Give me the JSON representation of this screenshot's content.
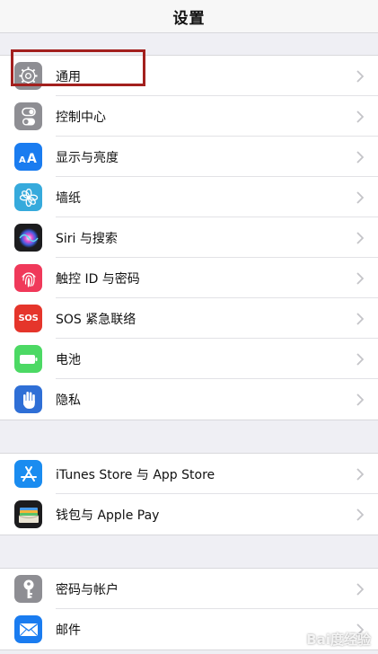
{
  "nav": {
    "title": "设置"
  },
  "groups": [
    {
      "items": [
        {
          "label": "通用",
          "icon": "gear-icon",
          "color": "#8e8e93"
        },
        {
          "label": "控制中心",
          "icon": "toggle-icon",
          "color": "#8e8e93"
        },
        {
          "label": "显示与亮度",
          "icon": "text-size-icon",
          "color": "#1a7cf0"
        },
        {
          "label": "墙纸",
          "icon": "flower-icon",
          "color": "#36aadc"
        },
        {
          "label": "Siri 与搜索",
          "icon": "siri-icon",
          "color": "#1c1c1e"
        },
        {
          "label": "触控 ID 与密码",
          "icon": "fingerprint-icon",
          "color": "#f0395a"
        },
        {
          "label": "SOS 紧急联络",
          "icon": "sos-icon",
          "color": "#e5352b",
          "text": "SOS"
        },
        {
          "label": "电池",
          "icon": "battery-icon",
          "color": "#4cd964"
        },
        {
          "label": "隐私",
          "icon": "hand-icon",
          "color": "#2f6fd6"
        }
      ]
    },
    {
      "items": [
        {
          "label": "iTunes Store 与 App Store",
          "icon": "app-store-icon",
          "color": "#1a8cf0"
        },
        {
          "label": "钱包与 Apple Pay",
          "icon": "wallet-icon",
          "color": "#1c1c1e"
        }
      ]
    },
    {
      "items": [
        {
          "label": "密码与帐户",
          "icon": "key-icon",
          "color": "#8e8e93"
        },
        {
          "label": "邮件",
          "icon": "mail-icon",
          "color": "#1a7cf0"
        }
      ]
    }
  ],
  "watermark": "Bai度经验"
}
